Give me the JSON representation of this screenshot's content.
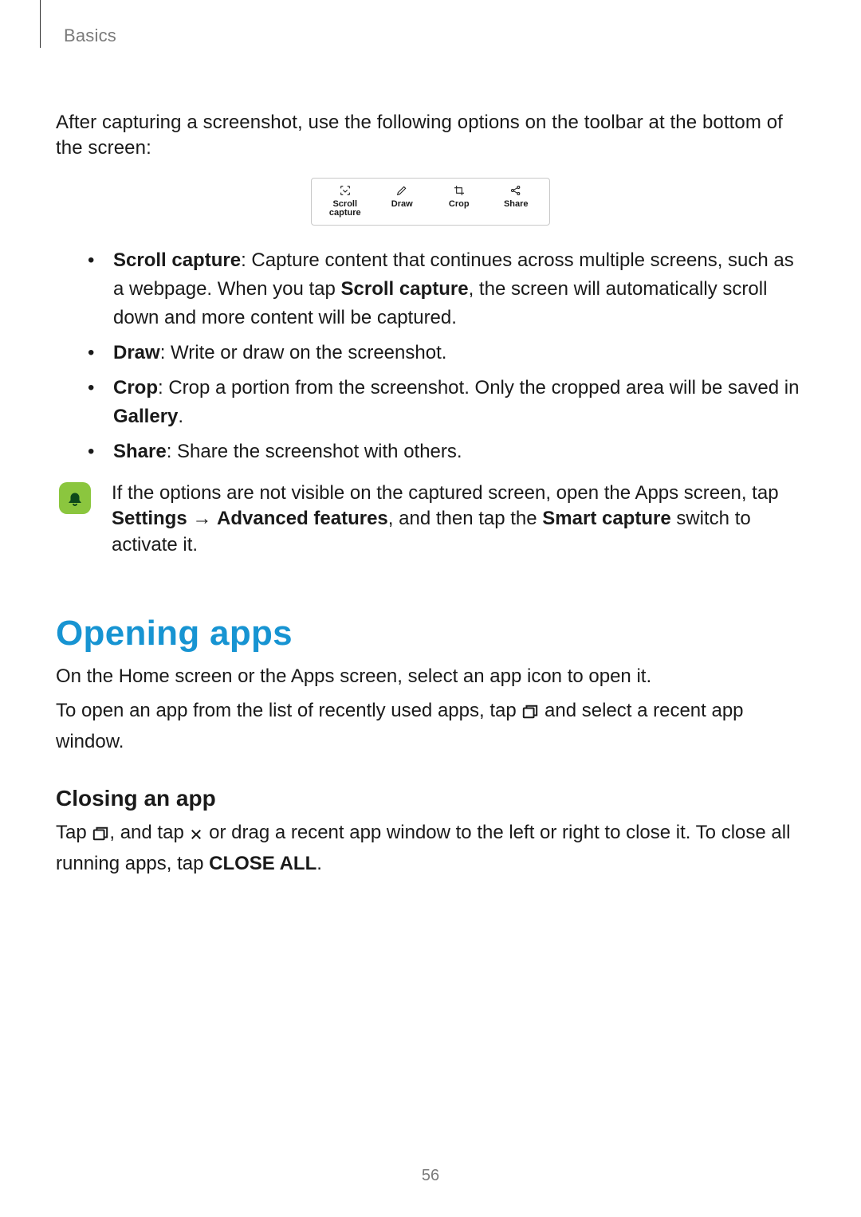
{
  "breadcrumb": "Basics",
  "intro": "After capturing a screenshot, use the following options on the toolbar at the bottom of the screen:",
  "toolbar": {
    "scroll_label": "Scroll",
    "scroll_sub": "capture",
    "draw_label": "Draw",
    "crop_label": "Crop",
    "share_label": "Share"
  },
  "bullets": {
    "scroll": {
      "lead": "Scroll capture",
      "text1": ": Capture content that continues across multiple screens, such as a webpage. When you tap ",
      "bold_inner": "Scroll capture",
      "text2": ", the screen will automatically scroll down and more content will be captured."
    },
    "draw": {
      "lead": "Draw",
      "text": ": Write or draw on the screenshot."
    },
    "crop": {
      "lead": "Crop",
      "text1": ": Crop a portion from the screenshot. Only the cropped area will be saved in ",
      "bold_inner": "Gallery",
      "text2": "."
    },
    "share": {
      "lead": "Share",
      "text": ": Share the screenshot with others."
    }
  },
  "note": {
    "text1": "If the options are not visible on the captured screen, open the Apps screen, tap ",
    "settings": "Settings",
    "arrow": " → ",
    "adv": "Advanced features",
    "text2": ", and then tap the ",
    "smart": "Smart capture",
    "text3": " switch to activate it."
  },
  "section_heading": "Opening apps",
  "open_p1": "On the Home screen or the Apps screen, select an app icon to open it.",
  "open_p2a": "To open an app from the list of recently used apps, tap ",
  "open_p2b": " and select a recent app window.",
  "closing_heading": "Closing an app",
  "close_p_a": "Tap ",
  "close_p_b": ", and tap ",
  "close_p_c": " or drag a recent app window to the left or right to close it. To close all running apps, tap ",
  "close_all": "CLOSE ALL",
  "close_p_d": ".",
  "page_number": "56"
}
